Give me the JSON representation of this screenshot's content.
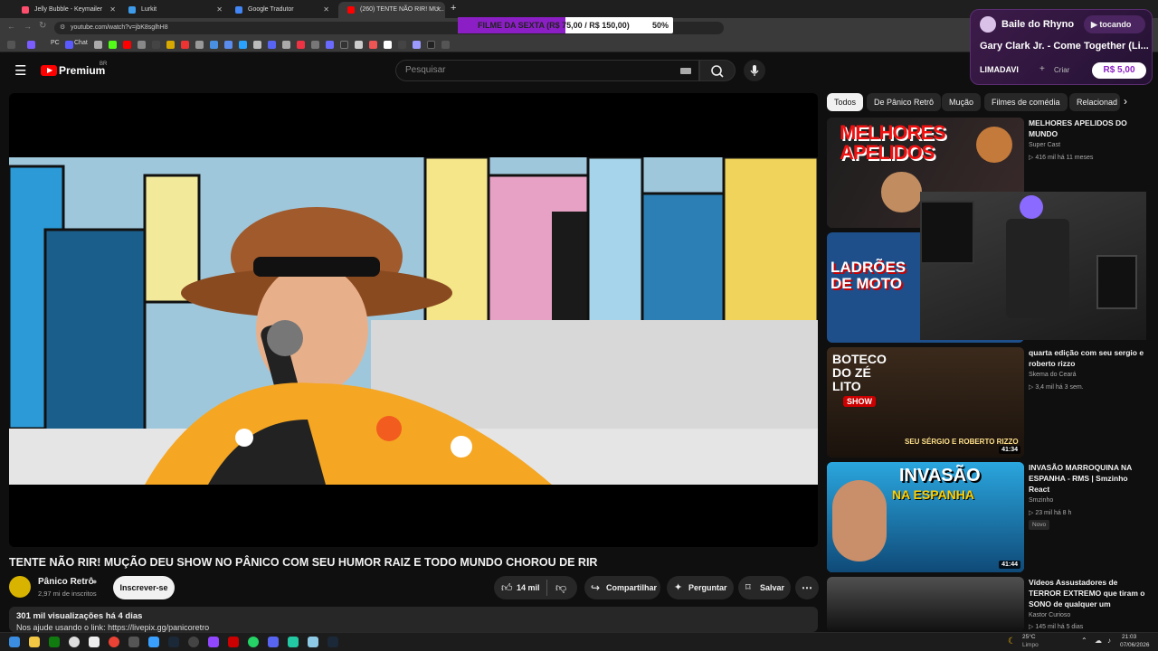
{
  "browser": {
    "tabs": [
      {
        "title": "Jelly Bubble - Keymailer",
        "color": "#ff4d6d"
      },
      {
        "title": "Lurkit",
        "color": "#3d9be9"
      },
      {
        "title": "Google Tradutor",
        "color": "#4285f4"
      },
      {
        "title": "(260) TENTE NÃO RIR! MU...",
        "color": "#ff0000"
      }
    ],
    "new_tab": "+",
    "url": "youtube.com/watch?v=jbK8sglhH8",
    "bookmarks": [
      "PC",
      "Chat"
    ]
  },
  "overlay_goal": {
    "text": "FILME DA SEXTA (R$ 75,00 / R$ 150,00)",
    "percent_label": "50%",
    "progress": 0.5,
    "fill_color": "#8b1ec4"
  },
  "header": {
    "logo": "Premium",
    "region": "BR",
    "search_placeholder": "Pesquisar"
  },
  "music_widget": {
    "channel": "Baile do Rhyno",
    "status": "tocando",
    "track": "Gary Clark Jr. - Come Together (Li...",
    "user": "LIMADAVI",
    "create": "Criar",
    "price": "R$ 5,00"
  },
  "video": {
    "title": "TENTE NÃO RIR! MUÇÃO DEU SHOW NO PÂNICO COM SEU HUMOR RAIZ E TODO MUNDO CHOROU DE RIR",
    "channel": "Pânico Retrô",
    "subscribers": "2,97 mi de inscritos",
    "subscribe": "Inscrever-se",
    "likes": "14 mil",
    "share": "Compartilhar",
    "ask": "Perguntar",
    "save": "Salvar",
    "views_line": "301 mil visualizações  há 4 dias",
    "desc_line": "Nos ajude usando o link: https://livepix.gg/panicoretro"
  },
  "chips": [
    "Todos",
    "De Pânico Retrô",
    "Mução",
    "Filmes de comédia",
    "Relacionad"
  ],
  "recommendations": [
    {
      "title": "MELHORES APELIDOS DO MUNDO",
      "channel": "Super Cast",
      "meta": "▷ 416 mil  há 11 meses",
      "duration": "",
      "badge": ""
    },
    {
      "title": "",
      "channel": "",
      "meta": "",
      "duration": "",
      "badge": ""
    },
    {
      "title": "quarta edição com seu sergio e roberto rizzo",
      "channel": "Skema do Ceará",
      "meta": "▷ 3,4 mil  há 3 sem.",
      "duration": "41:34",
      "badge": ""
    },
    {
      "title": "INVASÃO MARROQUINA NA ESPANHA - RMS | Smzinho React",
      "channel": "Smzinho",
      "meta": "▷ 23 mil  há 8 h",
      "duration": "41:44",
      "badge": "Novo"
    },
    {
      "title": "Vídeos Assustadores de TERROR EXTREMO que tiram o SONO de qualquer um",
      "channel": "Kastor Curioso",
      "meta": "▷ 145 mil  há 5 dias",
      "duration": "",
      "badge": ""
    }
  ],
  "thumb_text": {
    "t1": "MELHORES APELIDOS",
    "t2": "LADRÕES DE MOTO",
    "t3a": "BOTECO DO ZÉ LITO",
    "t3b": "SHOW",
    "t3c": "SEU SÉRGIO  E  ROBERTO RIZZO",
    "t4a": "INVASÃO",
    "t4b": "NA ESPANHA"
  },
  "taskbar": {
    "weather": "25°C",
    "weather_desc": "Limpo",
    "time": "21:03",
    "date": "07/06/2026"
  }
}
